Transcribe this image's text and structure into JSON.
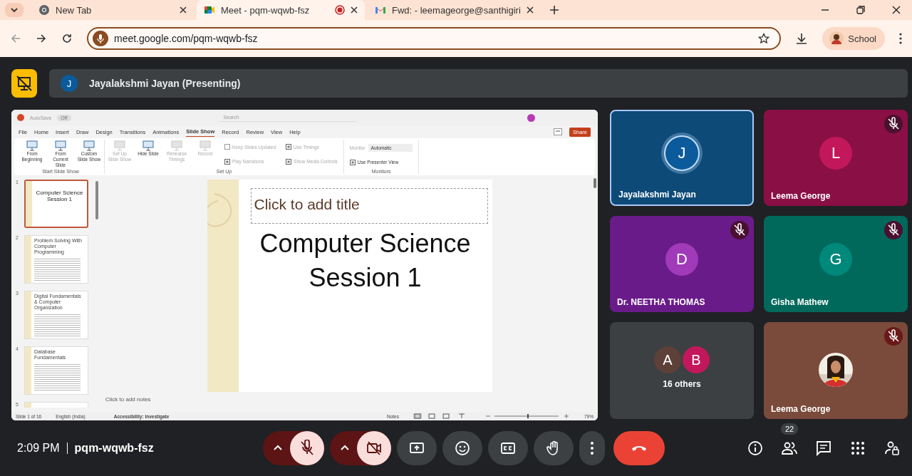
{
  "browser": {
    "tabs": [
      {
        "title": "New Tab",
        "selected": false,
        "recording": false
      },
      {
        "title": "Meet - pqm-wqwb-fsz",
        "selected": true,
        "recording": true
      },
      {
        "title": "Fwd: - leemageorge@santhigiri",
        "selected": false,
        "recording": false
      }
    ],
    "address": "meet.google.com/pqm-wqwb-fsz",
    "profile": "School"
  },
  "presenter_bar": {
    "avatar_letter": "J",
    "label": "Jayalakshmi Jayan (Presenting)"
  },
  "presentation": {
    "title_bar": {
      "autosave": "AutoSave",
      "autosave_state": "Off",
      "search": "Search"
    },
    "menu": [
      {
        "label": "File",
        "selected": false
      },
      {
        "label": "Home",
        "selected": false
      },
      {
        "label": "Insert",
        "selected": false
      },
      {
        "label": "Draw",
        "selected": false
      },
      {
        "label": "Design",
        "selected": false
      },
      {
        "label": "Transitions",
        "selected": false
      },
      {
        "label": "Animations",
        "selected": false
      },
      {
        "label": "Slide Show",
        "selected": true
      },
      {
        "label": "Record",
        "selected": false
      },
      {
        "label": "Review",
        "selected": false
      },
      {
        "label": "View",
        "selected": false
      },
      {
        "label": "Help",
        "selected": false
      }
    ],
    "share": "Share",
    "ribbon": [
      {
        "group": "Start Slide Show",
        "items": [
          {
            "kind": "big",
            "label": "From Beginning",
            "disabled": false
          },
          {
            "kind": "big",
            "label": "From Current Slide",
            "disabled": false
          },
          {
            "kind": "big",
            "label": "Custom Slide Show",
            "disabled": false
          }
        ]
      },
      {
        "group": "Set Up",
        "items": [
          {
            "kind": "big",
            "label": "Set Up Slide Show",
            "disabled": true
          },
          {
            "kind": "big",
            "label": "Hide Slide",
            "disabled": false
          },
          {
            "kind": "big",
            "label": "Rehearse Timings",
            "disabled": true
          },
          {
            "kind": "big",
            "label": "Record",
            "disabled": true
          },
          {
            "kind": "check",
            "label": "Keep Slides Updated",
            "disabled": true,
            "checked": false
          },
          {
            "kind": "check",
            "label": "Play Narrations",
            "disabled": true,
            "checked": true
          },
          {
            "kind": "check",
            "label": "Use Timings",
            "disabled": true,
            "checked": true
          },
          {
            "kind": "check",
            "label": "Show Media Controls",
            "disabled": true,
            "checked": true
          }
        ]
      },
      {
        "group": "Monitors",
        "items": [
          {
            "kind": "dropdown",
            "label": "Monitor",
            "value": "Automatic",
            "disabled": true
          },
          {
            "kind": "check",
            "label": "Use Presenter View",
            "disabled": false,
            "checked": true
          }
        ]
      }
    ],
    "thumbnails": [
      {
        "number": "1",
        "kind": "title",
        "title": "Computer Science Session 1",
        "selected": true
      },
      {
        "number": "2",
        "kind": "content",
        "title": "Problem Solving With Computer Programming",
        "selected": false
      },
      {
        "number": "3",
        "kind": "content",
        "title": "Digital Fundamentals & Computer Organization",
        "selected": false
      },
      {
        "number": "4",
        "kind": "content",
        "title": "Database Fundamentals",
        "selected": false
      },
      {
        "number": "5",
        "kind": "partial",
        "selected": false
      }
    ],
    "slide": {
      "title_placeholder": "Click to add title",
      "subtitle": "Computer Science Session 1"
    },
    "notes_placeholder": "Click to add notes",
    "status": {
      "slide": "Slide 1 of 16",
      "language": "English (India)",
      "accessibility": "Accessibility: Investigate",
      "notes": "Notes",
      "zoom": "79%"
    }
  },
  "tiles": [
    {
      "kind": "avatar",
      "name": "Jayalakshmi Jayan",
      "avatar": {
        "letter": "J",
        "color": "#0b5a9c"
      },
      "color": "#0d4a78",
      "muted": false,
      "speaking": true
    },
    {
      "kind": "avatar",
      "name": "Leema George",
      "avatar": {
        "letter": "L",
        "color": "#c2185b"
      },
      "color": "#8a0f45",
      "muted": true,
      "speaking": false
    },
    {
      "kind": "avatar",
      "name": "Dr. NEETHA THOMAS",
      "avatar": {
        "letter": "D",
        "color": "#a03ab8"
      },
      "color": "#6a1b8a",
      "muted": true,
      "speaking": false
    },
    {
      "kind": "avatar",
      "name": "Gisha Mathew",
      "avatar": {
        "letter": "G",
        "color": "#00897b"
      },
      "color": "#00695c",
      "muted": true,
      "speaking": false
    },
    {
      "kind": "group",
      "label": "16 others",
      "avatars": [
        {
          "letter": "A",
          "color": "#5d4037"
        },
        {
          "letter": "B",
          "color": "#c2185b"
        }
      ],
      "color": "#3c4043"
    },
    {
      "name": "Leema George",
      "color": "#7a4a3a",
      "muted": true,
      "speaking": false
    }
  ],
  "bottom_bar": {
    "time": "2:09 PM",
    "meeting_code": "pqm-wqwb-fsz",
    "controls": [
      {
        "kind": "mic",
        "on": false
      },
      {
        "kind": "camera",
        "on": false
      },
      {
        "kind": "present"
      },
      {
        "kind": "emoji"
      },
      {
        "kind": "captions"
      },
      {
        "kind": "hand"
      },
      {
        "kind": "more"
      },
      {
        "kind": "leave"
      }
    ],
    "side": [
      {
        "kind": "info"
      },
      {
        "kind": "people",
        "badge": "22"
      },
      {
        "kind": "chat"
      },
      {
        "kind": "apps"
      },
      {
        "kind": "host"
      }
    ]
  }
}
